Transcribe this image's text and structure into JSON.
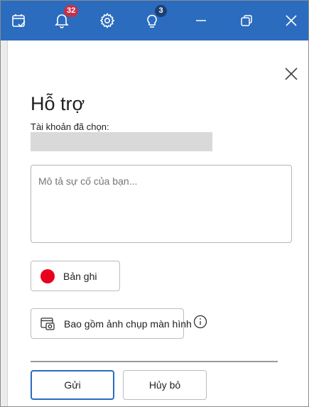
{
  "titlebar": {
    "color": "#2b6cbf",
    "buttons": [
      {
        "icon": "calendar-check-icon"
      },
      {
        "icon": "bell-icon",
        "badge": "32",
        "badge_color": "#c4314b"
      },
      {
        "icon": "gear-icon"
      },
      {
        "icon": "lightbulb-icon",
        "badge": "3",
        "badge_color": "#1d3f73"
      },
      {
        "icon": "minimize-icon"
      },
      {
        "icon": "restore-icon"
      },
      {
        "icon": "close-icon"
      }
    ]
  },
  "panel": {
    "title": "Hỗ trợ",
    "account_label": "Tài khoản đã chọn:",
    "description_placeholder": "Mô tả sự cố của bạn...",
    "record_button": "Bản ghi",
    "record_color": "#e8001c",
    "screenshot_button": "Bao gồm ảnh chụp màn hình",
    "send_button": "Gửi",
    "cancel_button": "Hủy bỏ"
  }
}
